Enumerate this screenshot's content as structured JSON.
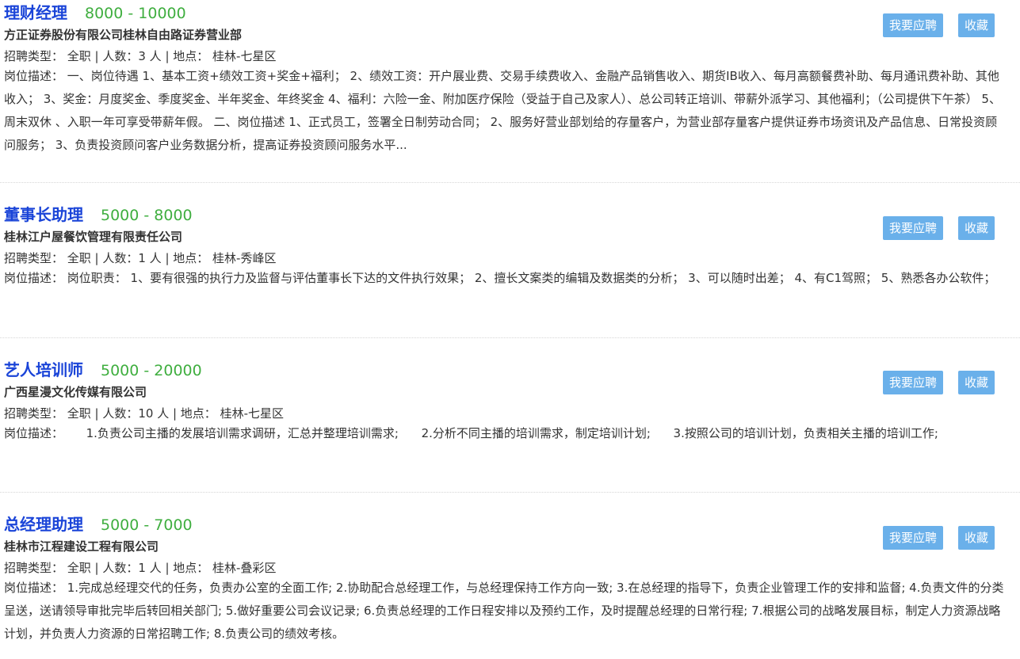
{
  "labels": {
    "type_prefix": "招聘类型：",
    "count_prefix": "人数：",
    "location_prefix": "地点：",
    "desc_prefix": "岗位描述：",
    "apply_button": "我要应聘",
    "favorite_button": "收藏"
  },
  "colors": {
    "title": "#1a44d8",
    "salary": "#3fae3f",
    "button": "#6ab0ea"
  },
  "jobs": [
    {
      "title": "理财经理",
      "salary": "8000 - 10000",
      "company": "方正证券股份有限公司桂林自由路证券营业部",
      "meta": "招聘类型：  全职 | 人数：3 人 | 地点：  桂林-七星区",
      "desc": "岗位描述：  一、岗位待遇 1、基本工资+绩效工资+奖金+福利； 2、绩效工资：开户展业费、交易手续费收入、金融产品销售收入、期货IB收入、每月高额餐费补助、每月通讯费补助、其他收入； 3、奖金：月度奖金、季度奖金、半年奖金、年终奖金 4、福利：六险一金、附加医疗保险（受益于自己及家人）、总公司转正培训、带薪外派学习、其他福利；（公司提供下午茶） 5、周末双休 、入职一年可享受带薪年假。 二、岗位描述 1、正式员工，签署全日制劳动合同； 2、服务好营业部划给的存量客户，为营业部存量客户提供证券市场资讯及产品信息、日常投资顾问服务； 3、负责投资顾问客户业务数据分析，提高证券投资顾问服务水平..."
    },
    {
      "title": "董事长助理",
      "salary": "5000 - 8000",
      "company": "桂林江户屋餐饮管理有限责任公司",
      "meta": "招聘类型：  全职 | 人数：1 人 | 地点：  桂林-秀峰区",
      "desc": "岗位描述：  岗位职责： 1、要有很强的执行力及监督与评估董事长下达的文件执行效果； 2、擅长文案类的编辑及数据类的分析； 3、可以随时出差； 4、有C1驾照； 5、熟悉各办公软件；"
    },
    {
      "title": "艺人培训师",
      "salary": "5000 - 20000",
      "company": "广西星漫文化传媒有限公司",
      "meta": "招聘类型：  全职 | 人数：10 人 | 地点：  桂林-七星区",
      "desc": "岗位描述：      1.负责公司主播的发展培训需求调研，汇总并整理培训需求;      2.分析不同主播的培训需求，制定培训计划;      3.按照公司的培训计划，负责相关主播的培训工作;"
    },
    {
      "title": "总经理助理",
      "salary": "5000 - 7000",
      "company": "桂林市江程建设工程有限公司",
      "meta": "招聘类型：  全职 | 人数：1 人 | 地点：  桂林-叠彩区",
      "desc": "岗位描述：  1.完成总经理交代的任务，负责办公室的全面工作; 2.协助配合总经理工作，与总经理保持工作方向一致; 3.在总经理的指导下，负责企业管理工作的安排和监督; 4.负责文件的分类呈送，送请领导审批完毕后转回相关部门; 5.做好重要公司会议记录; 6.负责总经理的工作日程安排以及预约工作，及时提醒总经理的日常行程; 7.根据公司的战略发展目标，制定人力资源战略计划，并负责人力资源的日常招聘工作; 8.负责公司的绩效考核。"
    }
  ]
}
